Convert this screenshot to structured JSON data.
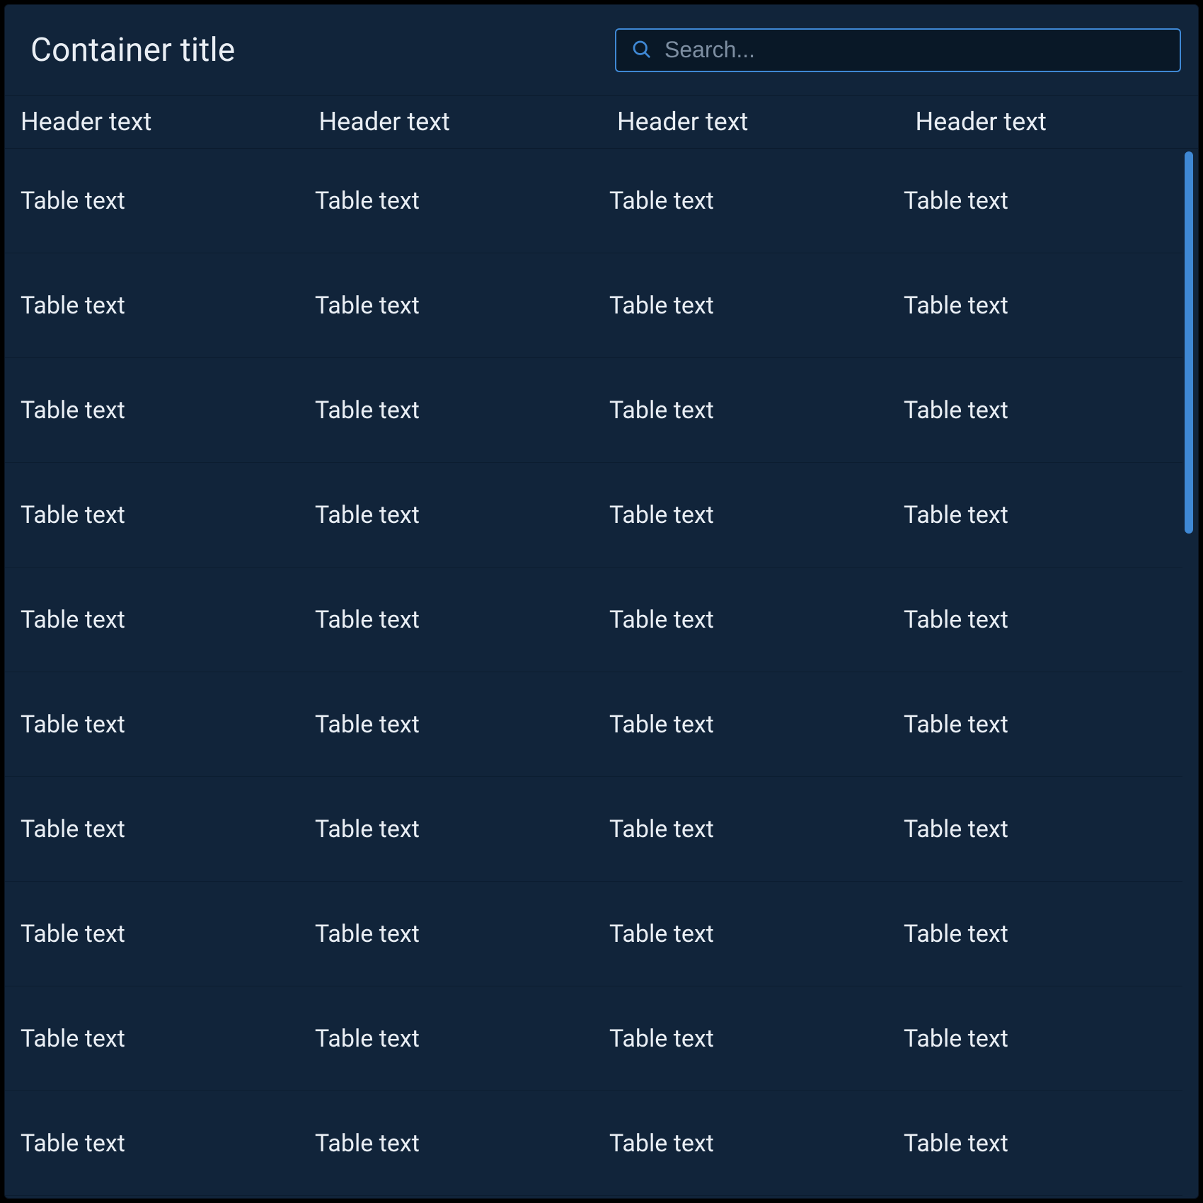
{
  "title": "Container title",
  "search": {
    "placeholder": "Search..."
  },
  "headers": [
    "Header text",
    "Header text",
    "Header text",
    "Header text"
  ],
  "rows": [
    [
      "Table text",
      "Table text",
      "Table text",
      "Table text"
    ],
    [
      "Table text",
      "Table text",
      "Table text",
      "Table text"
    ],
    [
      "Table text",
      "Table text",
      "Table text",
      "Table text"
    ],
    [
      "Table text",
      "Table text",
      "Table text",
      "Table text"
    ],
    [
      "Table text",
      "Table text",
      "Table text",
      "Table text"
    ],
    [
      "Table text",
      "Table text",
      "Table text",
      "Table text"
    ],
    [
      "Table text",
      "Table text",
      "Table text",
      "Table text"
    ],
    [
      "Table text",
      "Table text",
      "Table text",
      "Table text"
    ],
    [
      "Table text",
      "Table text",
      "Table text",
      "Table text"
    ],
    [
      "Table text",
      "Table text",
      "Table text",
      "Table text"
    ]
  ],
  "colors": {
    "accent": "#3f88d4",
    "bg": "#11243a",
    "text": "#e9eef4"
  }
}
